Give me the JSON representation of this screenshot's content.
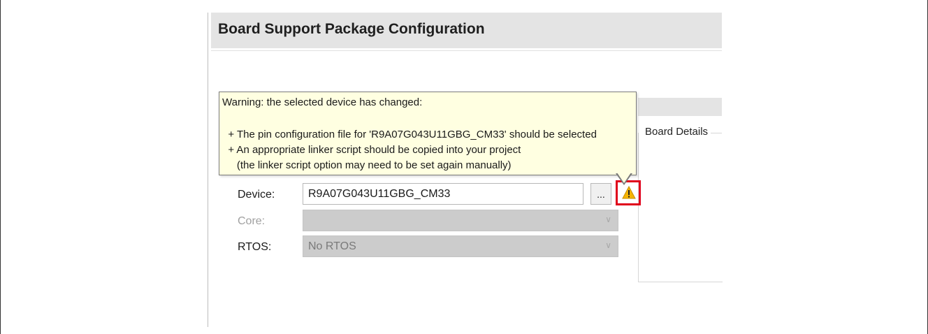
{
  "header": {
    "title": "Board Support Package Configuration"
  },
  "tooltip": {
    "lines": [
      "Warning: the selected device has changed:",
      "",
      "  + The pin configuration file for 'R9A07G043U11GBG_CM33' should be selected",
      "  + An appropriate linker script should be copied into your project",
      "     (the linker script option may need to be set again manually)"
    ]
  },
  "board_details": {
    "label": "Board Details"
  },
  "form": {
    "device_label": "Device:",
    "device_value": "R9A07G043U11GBG_CM33",
    "browse_label": "...",
    "core_label": "Core:",
    "core_value": "",
    "rtos_label": "RTOS:",
    "rtos_value": "No RTOS"
  },
  "icons": {
    "warning": "warning-triangle-icon",
    "dropdown": "chevron-down-icon"
  },
  "colors": {
    "tooltip_bg": "#ffffe1",
    "highlight_box": "#e0001b",
    "warning_icon": "#f5b400"
  }
}
